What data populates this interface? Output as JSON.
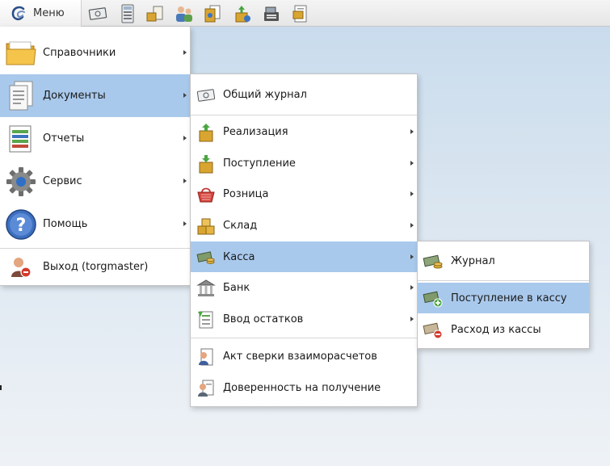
{
  "toolbar": {
    "menu_label": "Меню",
    "quick_icons": [
      "money-icon",
      "calculator-icon",
      "goods-receipt-icon",
      "users-icon",
      "documents-icon",
      "goods-upload-icon",
      "cash-register-icon",
      "report-icon"
    ]
  },
  "main_menu": {
    "items": [
      {
        "label": "Справочники",
        "icon": "folder-icon",
        "has_submenu": true
      },
      {
        "label": "Документы",
        "icon": "documents-icon",
        "has_submenu": true,
        "selected": true
      },
      {
        "label": "Отчеты",
        "icon": "reports-icon",
        "has_submenu": true
      },
      {
        "label": "Сервис",
        "icon": "gear-icon",
        "has_submenu": true
      },
      {
        "label": "Помощь",
        "icon": "help-icon",
        "has_submenu": true
      },
      {
        "label": "Выход (torgmaster)",
        "icon": "logout-icon",
        "has_submenu": false
      }
    ]
  },
  "documents_menu": {
    "items": [
      {
        "label": "Общий журнал",
        "icon": "journal-icon",
        "has_submenu": false
      },
      {
        "label": "Реализация",
        "icon": "sale-box-icon",
        "has_submenu": true
      },
      {
        "label": "Поступление",
        "icon": "receipt-box-icon",
        "has_submenu": true
      },
      {
        "label": "Розница",
        "icon": "basket-icon",
        "has_submenu": true
      },
      {
        "label": "Склад",
        "icon": "warehouse-boxes-icon",
        "has_submenu": true
      },
      {
        "label": "Касса",
        "icon": "cash-icon",
        "has_submenu": true,
        "selected": true
      },
      {
        "label": "Банк",
        "icon": "bank-icon",
        "has_submenu": true
      },
      {
        "label": "Ввод остатков",
        "icon": "balance-input-icon",
        "has_submenu": true
      },
      {
        "label": "Акт сверки взаиморасчетов",
        "icon": "reconciliation-icon",
        "has_submenu": false
      },
      {
        "label": "Доверенность на получение",
        "icon": "power-of-attorney-icon",
        "has_submenu": false
      }
    ]
  },
  "cash_menu": {
    "items": [
      {
        "label": "Журнал",
        "icon": "cash-journal-icon"
      },
      {
        "label": "Поступление в кассу",
        "icon": "cash-in-icon",
        "selected": true
      },
      {
        "label": "Расход из кассы",
        "icon": "cash-out-icon"
      }
    ]
  },
  "colors": {
    "selection": "#a9c9ec",
    "menu_background": "#ffffff",
    "desktop_background": "#d6e3ef"
  }
}
